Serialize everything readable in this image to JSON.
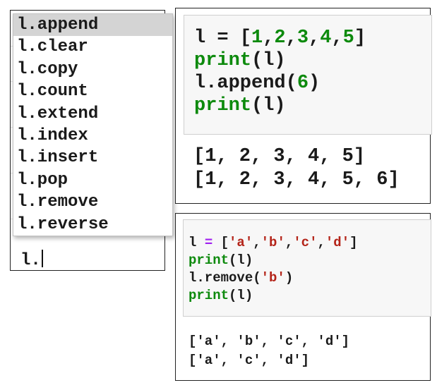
{
  "autocomplete": {
    "items": [
      {
        "label": "l.append",
        "selected": true
      },
      {
        "label": "l.clear"
      },
      {
        "label": "l.copy"
      },
      {
        "label": "l.count"
      },
      {
        "label": "l.extend"
      },
      {
        "label": "l.index"
      },
      {
        "label": "l.insert"
      },
      {
        "label": "l.pop"
      },
      {
        "label": "l.remove"
      },
      {
        "label": "l.reverse"
      }
    ],
    "editor_text": "l."
  },
  "cell1": {
    "code": [
      {
        "t1": "l = [",
        "n1": "1",
        "c1": ",",
        "n2": "2",
        "c2": ",",
        "n3": "3",
        "c3": ",",
        "n4": "4",
        "c4": ",",
        "n5": "5",
        "t2": "]"
      },
      {
        "fn": "print",
        "p1": "(",
        "arg": "l",
        "p2": ")"
      },
      {
        "t1": "l.append(",
        "n1": "6",
        "t2": ")"
      },
      {
        "fn": "print",
        "p1": "(",
        "arg": "l",
        "p2": ")"
      }
    ],
    "output": [
      "[1, 2, 3, 4, 5]",
      "[1, 2, 3, 4, 5, 6]"
    ]
  },
  "cell2": {
    "code": [
      {
        "t1": "l ",
        "op": "=",
        "t2": " [",
        "s1": "'a'",
        "c1": ",",
        "s2": "'b'",
        "c2": ",",
        "s3": "'c'",
        "c3": ",",
        "s4": "'d'",
        "t3": "]"
      },
      {
        "fn": "print",
        "rest": "(l)"
      },
      {
        "t1": "l.remove(",
        "s1": "'b'",
        "t2": ")"
      },
      {
        "fn": "print",
        "rest": "(l)"
      }
    ],
    "output": [
      "['a', 'b', 'c', 'd']",
      "['a', 'c', 'd']"
    ]
  },
  "colors": {
    "number": "#0d8a0d",
    "builtin": "#0d8a0d",
    "string": "#b42419",
    "operator": "#a020f0",
    "selected_bg": "#d4d4d4"
  }
}
